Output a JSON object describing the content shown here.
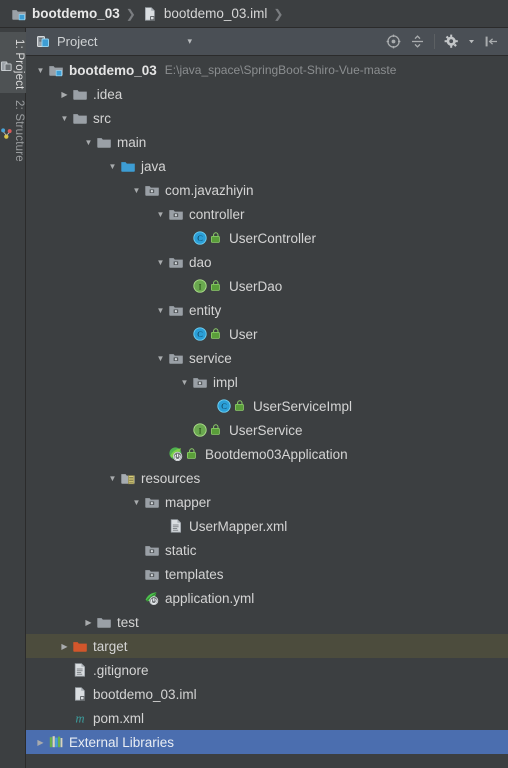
{
  "breadcrumb": {
    "items": [
      {
        "label": "bootdemo_03",
        "icon": "module-icon",
        "bold": true
      },
      {
        "label": "bootdemo_03.iml",
        "icon": "iml-file-icon",
        "bold": false
      }
    ],
    "separator": "❯"
  },
  "side_tabs": [
    {
      "label": "1: Project",
      "icon": "project-tab-icon",
      "active": true
    },
    {
      "label": "2: Structure",
      "icon": "structure-tab-icon",
      "active": false
    }
  ],
  "panel": {
    "title": "Project",
    "icon": "project-view-icon",
    "caret": "▾",
    "tools": [
      {
        "name": "scroll-from-source-icon",
        "tooltip": "Select Opened File"
      },
      {
        "name": "collapse-all-icon",
        "tooltip": "Collapse All"
      },
      {
        "name": "settings-gear-icon",
        "tooltip": "Show Options Menu"
      },
      {
        "name": "hide-panel-icon",
        "tooltip": "Hide"
      }
    ]
  },
  "colors": {
    "background": "#3c3f41",
    "panel_header": "#4a4f55",
    "selection": "#4b6eaf",
    "hover": "#4c4c3d",
    "text": "#d4d4d4",
    "muted_text": "#8b8e90",
    "folder": "#9aa0a6",
    "source_root": "#3d9dd4",
    "target_folder": "#d2562b",
    "class_icon": "#2b9fd8",
    "interface_icon": "#6aa84f",
    "vcs_badge": "#5a9e3a",
    "spring_icon": "#5fb832",
    "maven_icon": "#3c9f9f"
  },
  "tree": [
    {
      "label": "bootdemo_03",
      "sub": "E:\\java_space\\SpringBoot-Shiro-Vue-maste",
      "depth": 0,
      "arrow": "expanded",
      "icon": "module-icon",
      "badge": "none",
      "bold": true,
      "state": "normal"
    },
    {
      "label": ".idea",
      "sub": "",
      "depth": 1,
      "arrow": "collapsed",
      "icon": "folder-icon",
      "badge": "none",
      "bold": false,
      "state": "normal"
    },
    {
      "label": "src",
      "sub": "",
      "depth": 1,
      "arrow": "expanded",
      "icon": "folder-icon",
      "badge": "none",
      "bold": false,
      "state": "normal"
    },
    {
      "label": "main",
      "sub": "",
      "depth": 2,
      "arrow": "expanded",
      "icon": "folder-icon",
      "badge": "none",
      "bold": false,
      "state": "normal"
    },
    {
      "label": "java",
      "sub": "",
      "depth": 3,
      "arrow": "expanded",
      "icon": "source-root-icon",
      "badge": "none",
      "bold": false,
      "state": "normal"
    },
    {
      "label": "com.javazhiyin",
      "sub": "",
      "depth": 4,
      "arrow": "expanded",
      "icon": "package-icon",
      "badge": "none",
      "bold": false,
      "state": "normal"
    },
    {
      "label": "controller",
      "sub": "",
      "depth": 5,
      "arrow": "expanded",
      "icon": "package-icon",
      "badge": "none",
      "bold": false,
      "state": "normal"
    },
    {
      "label": "UserController",
      "sub": "",
      "depth": 6,
      "arrow": "none",
      "icon": "java-class-icon",
      "badge": "vcs-badge",
      "bold": false,
      "state": "normal"
    },
    {
      "label": "dao",
      "sub": "",
      "depth": 5,
      "arrow": "expanded",
      "icon": "package-icon",
      "badge": "none",
      "bold": false,
      "state": "normal"
    },
    {
      "label": "UserDao",
      "sub": "",
      "depth": 6,
      "arrow": "none",
      "icon": "java-interface-icon",
      "badge": "vcs-badge",
      "bold": false,
      "state": "normal"
    },
    {
      "label": "entity",
      "sub": "",
      "depth": 5,
      "arrow": "expanded",
      "icon": "package-icon",
      "badge": "none",
      "bold": false,
      "state": "normal"
    },
    {
      "label": "User",
      "sub": "",
      "depth": 6,
      "arrow": "none",
      "icon": "java-class-icon",
      "badge": "vcs-badge",
      "bold": false,
      "state": "normal"
    },
    {
      "label": "service",
      "sub": "",
      "depth": 5,
      "arrow": "expanded",
      "icon": "package-icon",
      "badge": "none",
      "bold": false,
      "state": "normal"
    },
    {
      "label": "impl",
      "sub": "",
      "depth": 6,
      "arrow": "expanded",
      "icon": "package-icon",
      "badge": "none",
      "bold": false,
      "state": "normal"
    },
    {
      "label": "UserServiceImpl",
      "sub": "",
      "depth": 7,
      "arrow": "none",
      "icon": "java-class-icon",
      "badge": "vcs-badge",
      "bold": false,
      "state": "normal"
    },
    {
      "label": "UserService",
      "sub": "",
      "depth": 6,
      "arrow": "none",
      "icon": "java-interface-icon",
      "badge": "vcs-badge",
      "bold": false,
      "state": "normal"
    },
    {
      "label": "Bootdemo03Application",
      "sub": "",
      "depth": 5,
      "arrow": "none",
      "icon": "spring-boot-icon",
      "badge": "vcs-badge",
      "bold": false,
      "state": "normal"
    },
    {
      "label": "resources",
      "sub": "",
      "depth": 3,
      "arrow": "expanded",
      "icon": "resource-root-icon",
      "badge": "none",
      "bold": false,
      "state": "normal"
    },
    {
      "label": "mapper",
      "sub": "",
      "depth": 4,
      "arrow": "expanded",
      "icon": "package-icon",
      "badge": "none",
      "bold": false,
      "state": "normal"
    },
    {
      "label": "UserMapper.xml",
      "sub": "",
      "depth": 5,
      "arrow": "none",
      "icon": "xml-file-icon",
      "badge": "none",
      "bold": false,
      "state": "normal"
    },
    {
      "label": "static",
      "sub": "",
      "depth": 4,
      "arrow": "none",
      "icon": "package-icon",
      "badge": "none",
      "bold": false,
      "state": "normal"
    },
    {
      "label": "templates",
      "sub": "",
      "depth": 4,
      "arrow": "none",
      "icon": "package-icon",
      "badge": "none",
      "bold": false,
      "state": "normal"
    },
    {
      "label": "application.yml",
      "sub": "",
      "depth": 4,
      "arrow": "none",
      "icon": "spring-yaml-icon",
      "badge": "none",
      "bold": false,
      "state": "normal"
    },
    {
      "label": "test",
      "sub": "",
      "depth": 2,
      "arrow": "collapsed",
      "icon": "folder-icon",
      "badge": "none",
      "bold": false,
      "state": "normal"
    },
    {
      "label": "target",
      "sub": "",
      "depth": 1,
      "arrow": "collapsed",
      "icon": "target-folder-icon",
      "badge": "none",
      "bold": false,
      "state": "hovered"
    },
    {
      "label": ".gitignore",
      "sub": "",
      "depth": 1,
      "arrow": "none",
      "icon": "text-file-icon",
      "badge": "none",
      "bold": false,
      "state": "normal"
    },
    {
      "label": "bootdemo_03.iml",
      "sub": "",
      "depth": 1,
      "arrow": "none",
      "icon": "iml-file-icon",
      "badge": "none",
      "bold": false,
      "state": "normal"
    },
    {
      "label": "pom.xml",
      "sub": "",
      "depth": 1,
      "arrow": "none",
      "icon": "maven-icon",
      "badge": "none",
      "bold": false,
      "state": "normal"
    },
    {
      "label": "External Libraries",
      "sub": "",
      "depth": 0,
      "arrow": "collapsed",
      "icon": "libraries-icon",
      "badge": "none",
      "bold": false,
      "state": "selected"
    }
  ]
}
